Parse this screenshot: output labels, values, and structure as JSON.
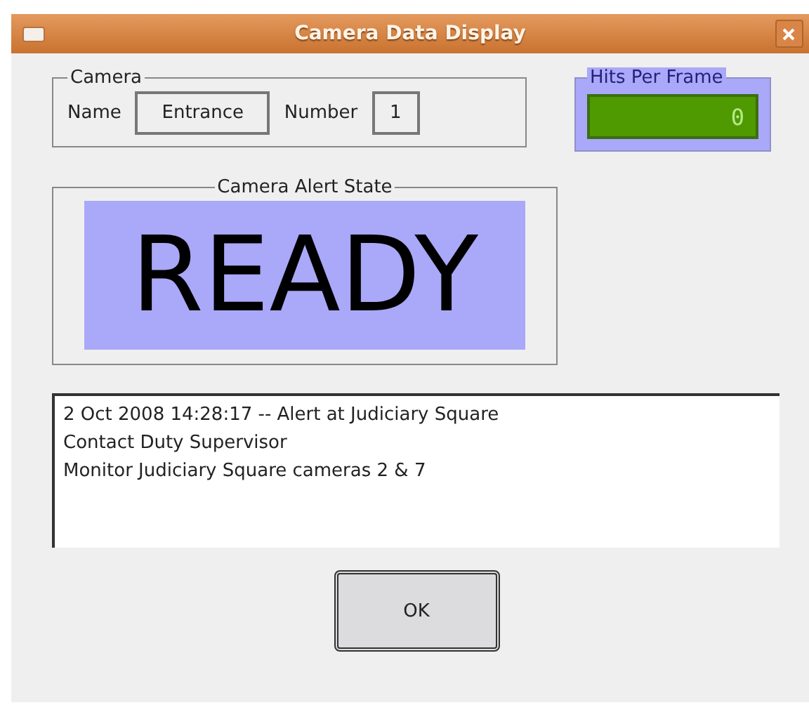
{
  "window": {
    "title": "Camera Data Display"
  },
  "camera": {
    "legend": "Camera",
    "name_label": "Name",
    "name_value": "Entrance",
    "number_label": "Number",
    "number_value": "1"
  },
  "hits_per_frame": {
    "legend": "Hits Per Frame",
    "value": "0"
  },
  "alert_state": {
    "legend": "Camera Alert State",
    "state": "READY"
  },
  "messages": [
    "2 Oct 2008 14:28:17 -- Alert at Judiciary Square",
    "Contact Duty Supervisor",
    "Monitor Judiciary Square cameras 2 & 7"
  ],
  "buttons": [
    "OK"
  ]
}
